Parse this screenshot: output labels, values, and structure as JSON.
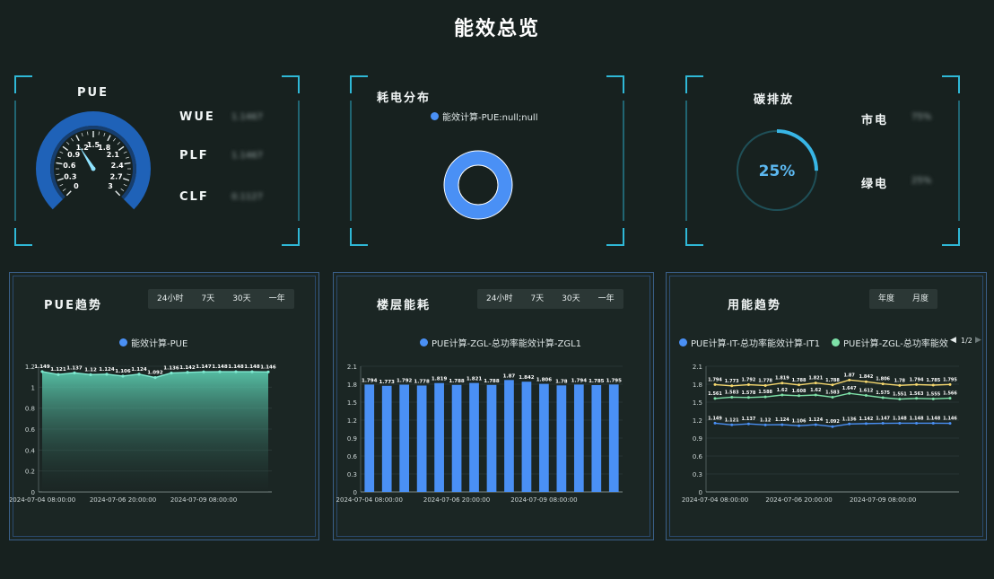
{
  "page_title": "能效总览",
  "colors": {
    "accent": "#2fb8d6",
    "blue": "#4a90f5",
    "green": "#7ee1a8",
    "yellow": "#f5d76e",
    "teal": "#5fd6b8"
  },
  "pue_panel": {
    "title": "PUE",
    "gauge": {
      "min": 0,
      "max": 3,
      "value": 1.146,
      "ticks": [
        "0",
        "0.3",
        "0.6",
        "0.9",
        "1.2",
        "1.5",
        "1.8",
        "2.1",
        "2.4",
        "2.7",
        "3"
      ]
    },
    "metrics": [
      {
        "label": "WUE",
        "value": "1.1467"
      },
      {
        "label": "PLF",
        "value": "1.1467"
      },
      {
        "label": "CLF",
        "value": "0.1127"
      }
    ]
  },
  "power_dist_panel": {
    "title": "耗电分布",
    "legend": "能效计算-PUE:null;null"
  },
  "carbon_panel": {
    "title": "碳排放",
    "percent": "25%",
    "fraction": 0.25,
    "items": [
      {
        "label": "市电",
        "value": "75%"
      },
      {
        "label": "绿电",
        "value": "25%"
      }
    ]
  },
  "pue_trend": {
    "title": "PUE趋势",
    "tabs": [
      "24小时",
      "7天",
      "30天",
      "一年"
    ],
    "legend": "能效计算-PUE"
  },
  "floor_energy": {
    "title": "楼层能耗",
    "tabs": [
      "24小时",
      "7天",
      "30天",
      "一年"
    ],
    "legend": "PUE计算-ZGL-总功率能效计算-ZGL1"
  },
  "energy_trend": {
    "title": "用能趋势",
    "tabs": [
      "年度",
      "月度"
    ],
    "legend": [
      "PUE计算-IT-总功率能效计算-IT1",
      "PUE计算-ZGL-总功率能效"
    ],
    "pager": "1/2"
  },
  "chart_data": [
    {
      "type": "area",
      "title": "PUE趋势",
      "series": [
        {
          "name": "能效计算-PUE",
          "values": [
            1.149,
            1.121,
            1.137,
            1.12,
            1.124,
            1.106,
            1.124,
            1.092,
            1.136,
            1.142,
            1.147,
            1.148,
            1.148,
            1.148,
            1.146
          ]
        }
      ],
      "x_tick_labels": [
        "2024-07-04 08:00:00",
        "2024-07-06 20:00:00",
        "2024-07-09 08:00:00"
      ],
      "y_tick_labels": [
        "0",
        "0.2",
        "0.4",
        "0.6",
        "0.8",
        "1",
        "1.2"
      ],
      "ylim": [
        0,
        1.2
      ]
    },
    {
      "type": "bar",
      "title": "楼层能耗",
      "series": [
        {
          "name": "PUE计算-ZGL-总功率能效计算-ZGL1",
          "values": [
            1.794,
            1.773,
            1.792,
            1.778,
            1.819,
            1.788,
            1.821,
            1.788,
            1.87,
            1.842,
            1.806,
            1.78,
            1.794,
            1.785,
            1.795
          ]
        }
      ],
      "x_tick_labels": [
        "2024-07-04 08:00:00",
        "2024-07-06 20:00:00",
        "2024-07-09 08:00:00"
      ],
      "y_tick_labels": [
        "0",
        "0.3",
        "0.6",
        "0.9",
        "1.2",
        "1.5",
        "1.8",
        "2.1"
      ],
      "ylim": [
        0,
        2.1
      ]
    },
    {
      "type": "line",
      "title": "用能趋势",
      "series": [
        {
          "name": "PUE计算-IT-总功率能效计算-IT1",
          "values": [
            1.149,
            1.121,
            1.137,
            1.12,
            1.124,
            1.106,
            1.124,
            1.092,
            1.136,
            1.142,
            1.147,
            1.148,
            1.148,
            1.148,
            1.146
          ]
        },
        {
          "name": "PUE计算-ZGL-总功率能效",
          "values": [
            1.561,
            1.583,
            1.578,
            1.588,
            1.62,
            1.608,
            1.62,
            1.583,
            1.647,
            1.612,
            1.575,
            1.551,
            1.563,
            1.555,
            1.566
          ]
        },
        {
          "values": [
            1.794,
            1.773,
            1.792,
            1.778,
            1.819,
            1.788,
            1.821,
            1.788,
            1.87,
            1.842,
            1.806,
            1.78,
            1.794,
            1.785,
            1.795
          ]
        }
      ],
      "x_tick_labels": [
        "2024-07-04 08:00:00",
        "2024-07-06 20:00:00",
        "2024-07-09 08:00:00"
      ],
      "y_tick_labels": [
        "0",
        "0.3",
        "0.6",
        "0.9",
        "1.2",
        "1.5",
        "1.8",
        "2.1"
      ],
      "ylim": [
        0,
        2.1
      ]
    }
  ]
}
